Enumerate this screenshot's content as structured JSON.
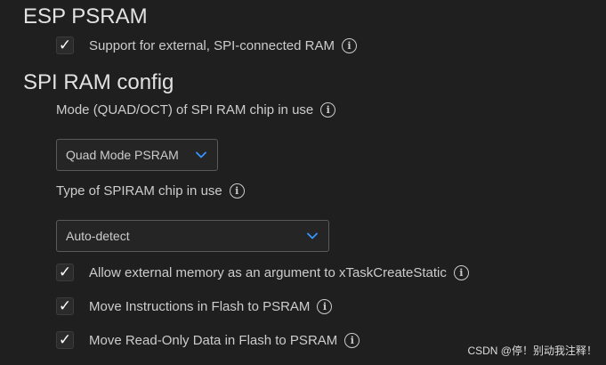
{
  "sections": {
    "esp_psram": {
      "title": "ESP PSRAM",
      "support_external": {
        "label": "Support for external, SPI-connected RAM",
        "checked": true,
        "check_glyph": "✓"
      }
    },
    "spi_ram_config": {
      "title": "SPI RAM config",
      "mode": {
        "label": "Mode (QUAD/OCT) of SPI RAM chip in use",
        "value": "Quad Mode PSRAM"
      },
      "chip_type": {
        "label": "Type of SPIRAM chip in use",
        "value": "Auto-detect"
      },
      "allow_external_memory": {
        "label": "Allow external memory as an argument to xTaskCreateStatic",
        "checked": true,
        "check_glyph": "✓"
      },
      "move_instructions": {
        "label": "Move Instructions in Flash to PSRAM",
        "checked": true,
        "check_glyph": "✓"
      },
      "move_rodata": {
        "label": "Move Read-Only Data in Flash to PSRAM",
        "checked": true,
        "check_glyph": "✓"
      }
    }
  },
  "icons": {
    "info": "info-icon",
    "dropdown": "chevron-down-icon",
    "check": "check-icon"
  },
  "info_glyph": "i",
  "colors": {
    "background": "#1f1f1f",
    "accent": "#3794ff",
    "text": "#cccccc"
  },
  "watermark": "CSDN @停！别动我注释！"
}
